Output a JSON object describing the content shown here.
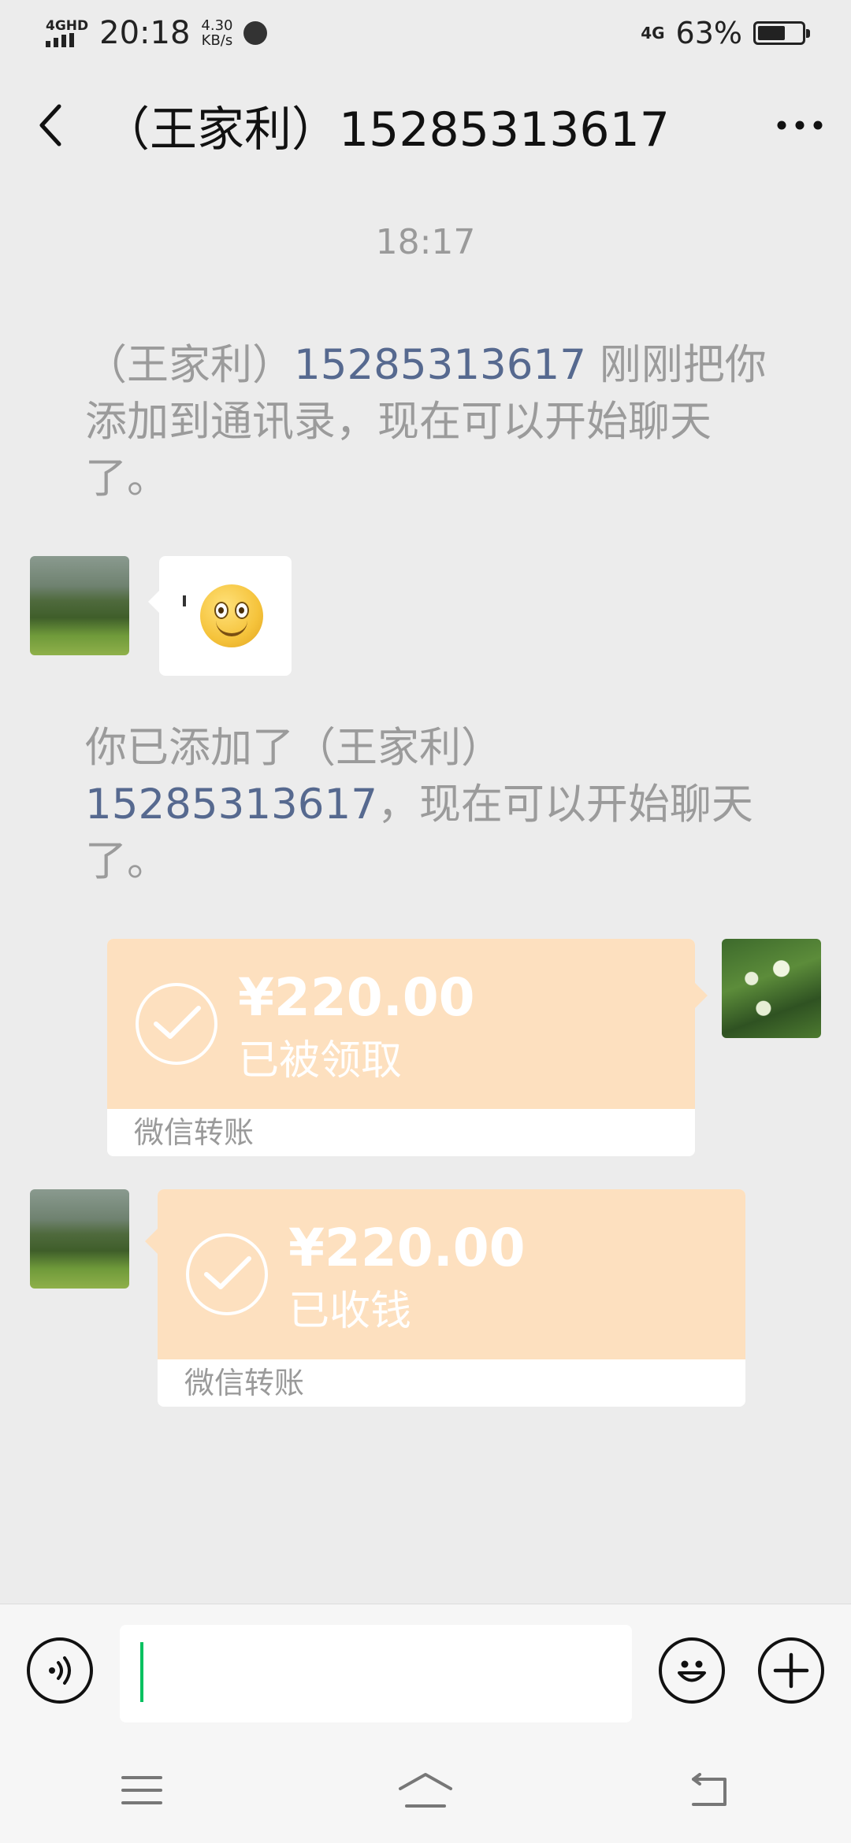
{
  "status_bar": {
    "network": "4GHD",
    "time": "20:18",
    "speed_value": "4.30",
    "speed_unit": "KB/s",
    "cell_type": "4G",
    "battery_percent": "63%",
    "battery_level": 0.63
  },
  "header": {
    "title": "（王家利）15285313617",
    "back_icon": "chevron-left-icon",
    "more_icon": "more-horizontal-icon"
  },
  "chat": {
    "timestamp": "18:17",
    "system_message_1": {
      "prefix": "（王家利）",
      "highlight": "15285313617",
      "suffix": " 刚刚把你添加到通讯录，现在可以开始聊天了。"
    },
    "emoji_message": {
      "text": "'",
      "emoji": "smiley-face"
    },
    "system_message_2": {
      "prefix": "你已添加了（王家利）",
      "highlight": "15285313617",
      "suffix": "，现在可以开始聊天了。"
    },
    "transfer_1": {
      "amount": "¥220.00",
      "status": "已被领取",
      "footer": "微信转账"
    },
    "transfer_2": {
      "amount": "¥220.00",
      "status": "已收钱",
      "footer": "微信转账"
    }
  },
  "input_bar": {
    "voice_icon": "voice-icon",
    "emoji_icon": "emoji-icon",
    "plus_icon": "plus-icon",
    "input_value": ""
  },
  "system_nav": {
    "menu_icon": "menu-icon",
    "home_icon": "home-icon",
    "back_icon": "back-icon"
  },
  "colors": {
    "background": "#ececec",
    "transfer_orange": "#fde0bf",
    "link_blue": "#56698f",
    "cursor_green": "#07c160"
  }
}
